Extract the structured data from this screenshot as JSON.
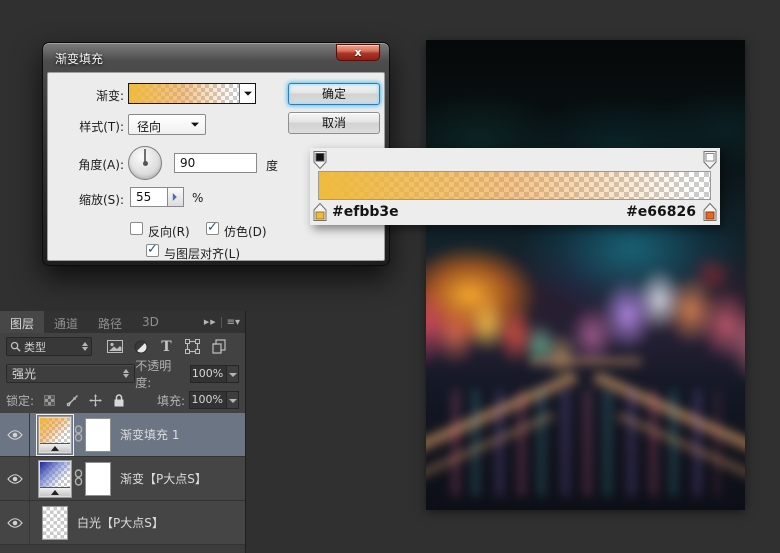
{
  "dialog": {
    "title": "渐变填充",
    "close_glyph": "x",
    "fields": {
      "gradient_label": "渐变:",
      "style_label": "样式(T):",
      "style_value": "径向",
      "angle_label": "角度(A):",
      "angle_value": "90",
      "angle_unit": "度",
      "scale_label": "缩放(S):",
      "scale_value": "55",
      "scale_unit": "%"
    },
    "checkboxes": {
      "reverse": {
        "label": "反向(R)",
        "checked": false
      },
      "dither": {
        "label": "仿色(D)",
        "checked": true
      },
      "align": {
        "label": "与图层对齐(L)",
        "checked": true
      }
    },
    "buttons": {
      "ok": "确定",
      "cancel": "取消"
    },
    "gradient": {
      "start_hex": "#efbb3e",
      "end_hex": "#e66826"
    }
  },
  "gradient_editor_strip": {
    "start_hex": "#efbb3e",
    "end_hex": "#e66826",
    "start_opacity_stop": "black-100%",
    "end_opacity_stop": "white-0%"
  },
  "layers_panel": {
    "tabs": [
      {
        "label": "图层",
        "active": true
      },
      {
        "label": "通道",
        "active": false
      },
      {
        "label": "路径",
        "active": false
      },
      {
        "label": "3D",
        "active": false
      }
    ],
    "filter_label": "类型",
    "blend_mode": "强光",
    "opacity_label": "不透明度:",
    "opacity_value": "100%",
    "lock_label": "锁定:",
    "fill_label": "填充:",
    "fill_value": "100%",
    "layers": [
      {
        "name": "渐变填充 1",
        "selected": true
      },
      {
        "name": "渐变【P大点S】",
        "selected": false
      },
      {
        "name": "白光【P大点S】",
        "selected": false
      }
    ]
  }
}
